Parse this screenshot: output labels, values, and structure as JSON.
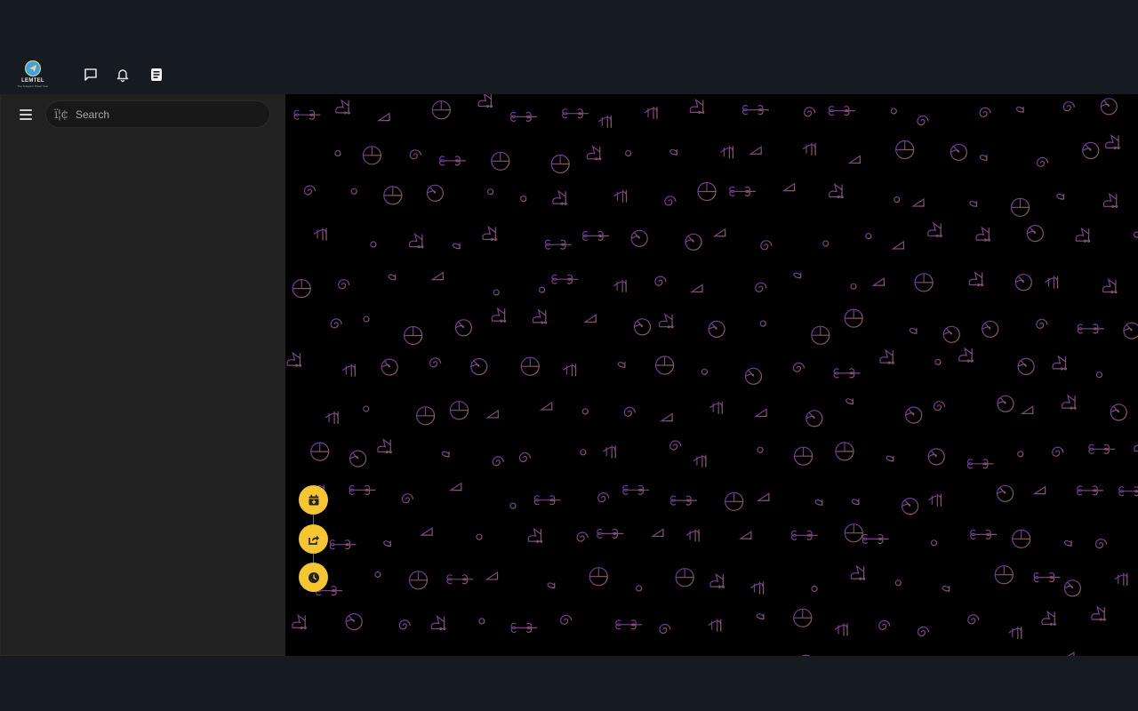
{
  "app": {
    "logo_name": "LEMTEL",
    "logo_tagline": "The Telegram Power User"
  },
  "topbar": {
    "icons": [
      {
        "name": "chats-icon",
        "glyph": "speech-bubble"
      },
      {
        "name": "notifications-icon",
        "glyph": "bell"
      },
      {
        "name": "notes-icon",
        "glyph": "document"
      }
    ]
  },
  "sidebar": {
    "menu_icon": "hamburger-icon",
    "search": {
      "placeholder": "Search",
      "value": "",
      "icon_text": "ï¦¢"
    }
  },
  "chat": {
    "background": "doodle-pattern",
    "pattern_colors": {
      "top_left": "#6a3aa0",
      "top_right": "#3c3f85",
      "bottom_left": "#7a3e86",
      "bottom_right": "#8a6a4e"
    },
    "fab_buttons": [
      {
        "name": "schedule-add-button",
        "icon": "calendar-plus-icon"
      },
      {
        "name": "share-button",
        "icon": "share-icon"
      },
      {
        "name": "history-button",
        "icon": "clock-icon"
      }
    ],
    "fab_color": "#f5c632"
  }
}
